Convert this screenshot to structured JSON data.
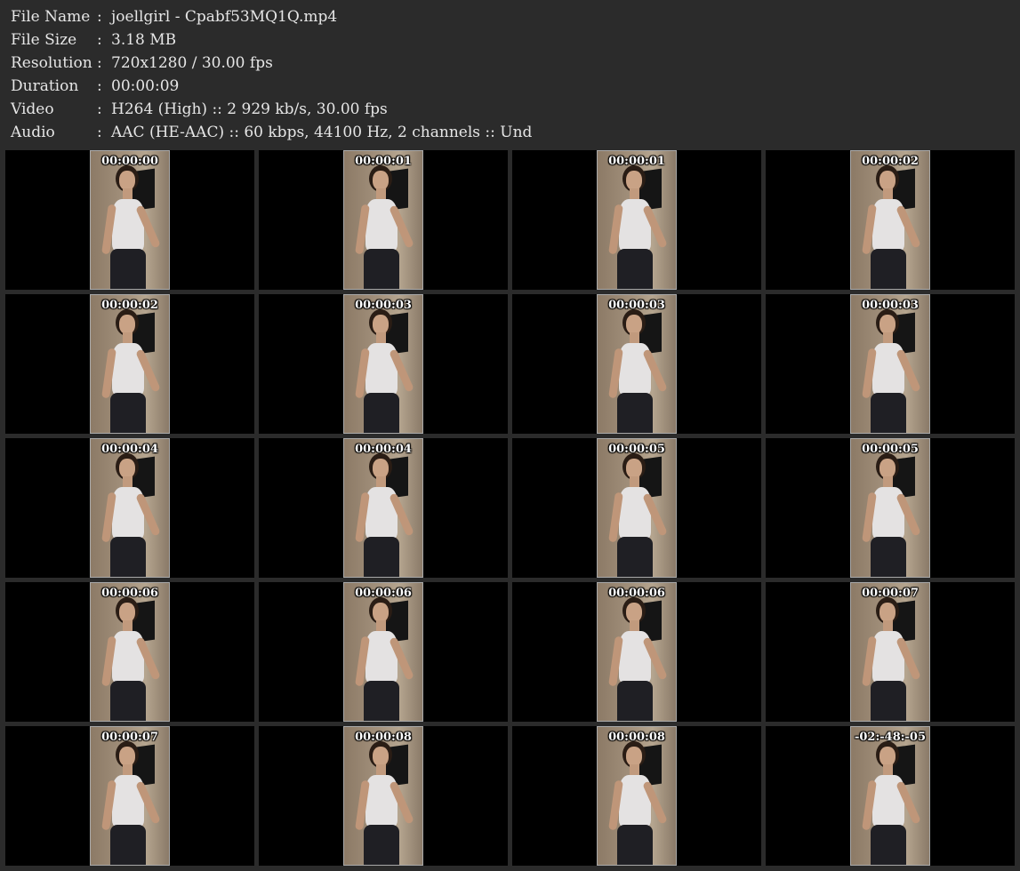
{
  "info": [
    {
      "label": "File Name",
      "value": "joellgirl - Cpabf53MQ1Q.mp4"
    },
    {
      "label": "File Size",
      "value": "3.18 MB"
    },
    {
      "label": "Resolution",
      "value": "720x1280 / 30.00 fps"
    },
    {
      "label": "Duration",
      "value": "00:00:09"
    },
    {
      "label": "Video",
      "value": "H264 (High) :: 2 929 kb/s, 30.00 fps"
    },
    {
      "label": "Audio",
      "value": "AAC (HE-AAC) :: 60 kbps, 44100 Hz, 2 channels :: Und"
    }
  ],
  "separator": ":",
  "thumbnails": [
    "00:00:00",
    "00:00:01",
    "00:00:01",
    "00:00:02",
    "00:00:02",
    "00:00:03",
    "00:00:03",
    "00:00:03",
    "00:00:04",
    "00:00:04",
    "00:00:05",
    "00:00:05",
    "00:00:06",
    "00:00:06",
    "00:00:06",
    "00:00:07",
    "00:00:07",
    "00:00:08",
    "00:00:08",
    "-02:-48:-05"
  ]
}
